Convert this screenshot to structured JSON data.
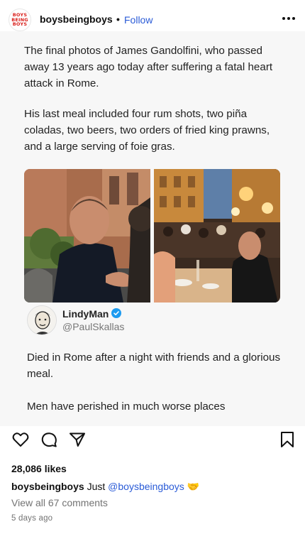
{
  "post_header": {
    "avatar_lines": [
      "BOYS",
      "BEING",
      "BOYS"
    ],
    "username": "boysbeingboys",
    "separator": "•",
    "follow_label": "Follow"
  },
  "post_image": {
    "tweet_paragraph_1": "The final photos of James Gandolfini, who passed away 13 years ago today after suffering a fatal heart attack in Rome.",
    "tweet_paragraph_2": "His last meal included four rum shots, two piña coladas, two beers, two orders of fried king prawns, and a large serving of foie gras.",
    "quote": {
      "name": "LindyMan",
      "handle": "@PaulSkallas",
      "paragraph_1": "Died in Rome after a night with friends and a glorious meal.",
      "paragraph_2": "Men have perished in much worse places"
    }
  },
  "actions": {
    "icons": [
      "heart-icon",
      "comment-icon",
      "share-icon",
      "bookmark-icon"
    ]
  },
  "likes": "28,086 likes",
  "caption": {
    "username": "boysbeingboys",
    "text": "Just",
    "mention": "@boysbeingboys",
    "emoji": "🤝"
  },
  "comments_link": "View all 67 comments",
  "timestamp": "5 days ago",
  "colors": {
    "link_blue": "#2a5bd7",
    "verified_blue": "#1d9bf0",
    "brand_red": "#d9201c"
  }
}
